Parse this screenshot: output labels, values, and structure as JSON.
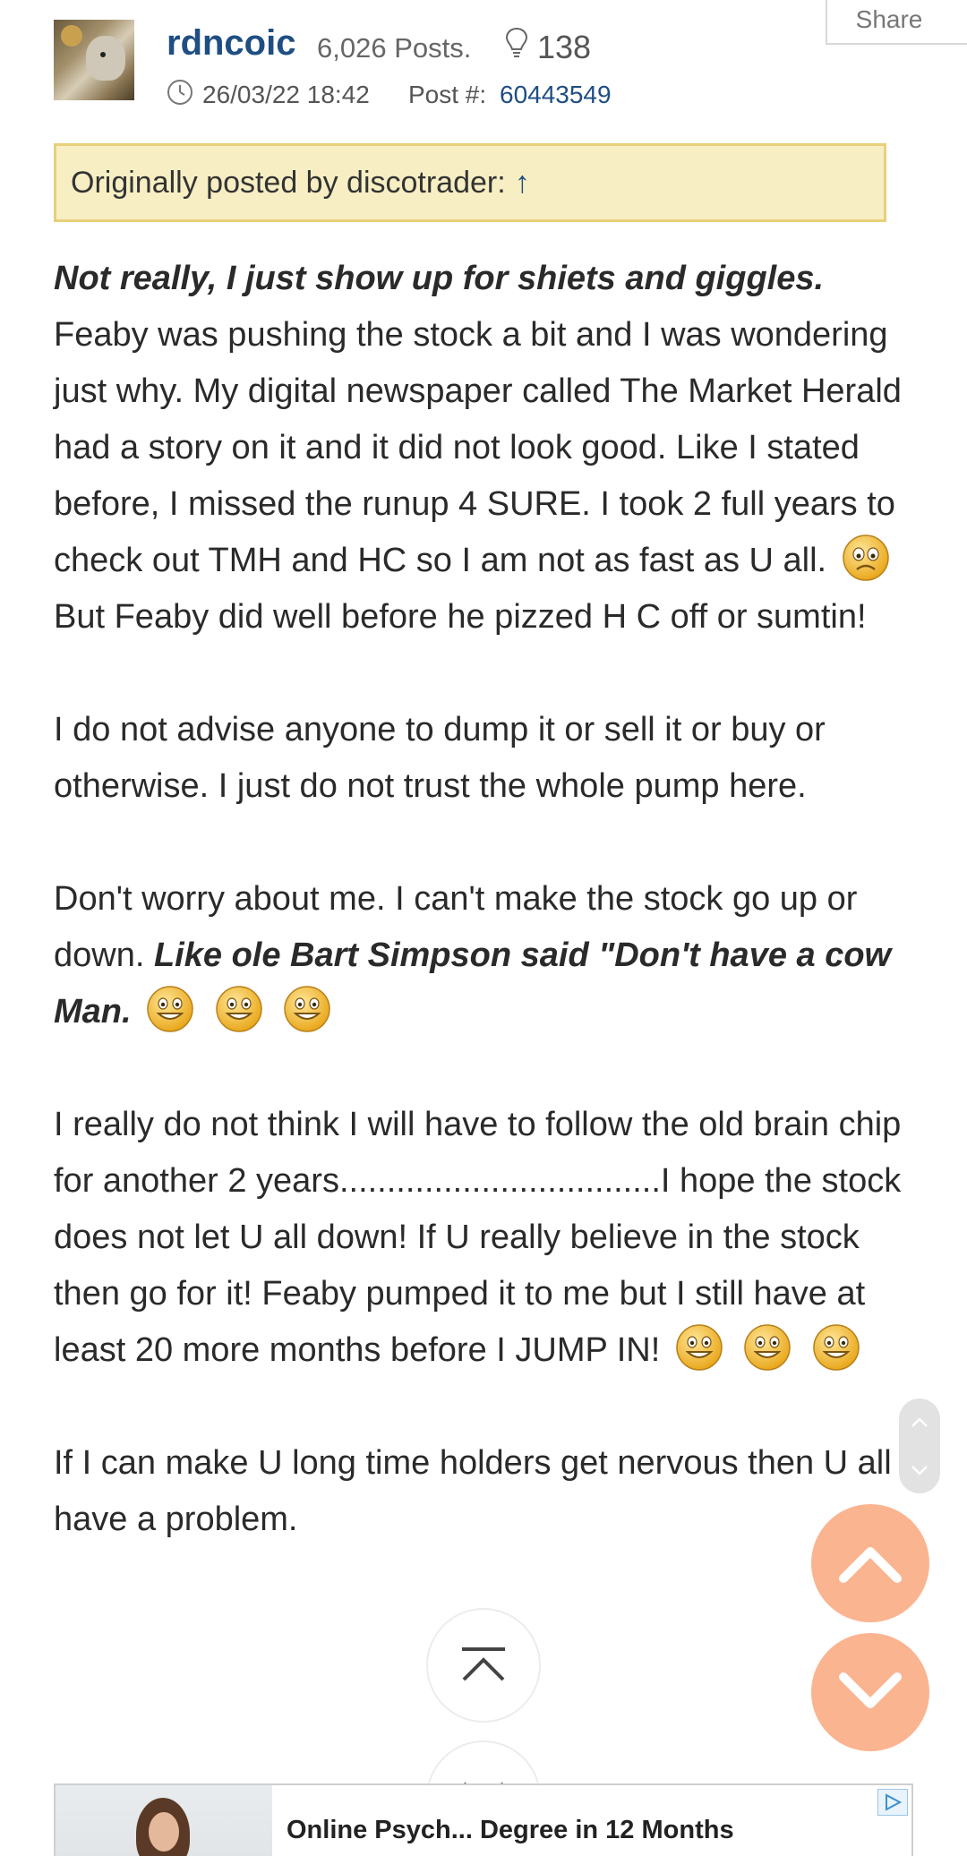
{
  "header": {
    "username": "rdncoic",
    "posts": "6,026 Posts.",
    "likes": "138",
    "datetime": "26/03/22 18:42",
    "post_label": "Post #:",
    "post_number": "60443549",
    "share_label": "Share"
  },
  "quote": {
    "label": "Originally posted by discotrader:",
    "arrow": "↑"
  },
  "body": {
    "p1_bold": "Not really, I just show up for shiets and giggles.",
    "p1_text": "Feaby was pushing the stock a bit and I was wondering just why. My digital newspaper called The Market Herald had a story on it and it did not look good. Like I stated before, I missed the runup 4 SURE. I took 2 full years to check out TMH and HC so I am not as fast as U all.",
    "p1_tail": "But Feaby did well before he pizzed H C off or sumtin!",
    "p2": "I do not advise anyone to dump it or sell it or buy or otherwise. I just do not trust the whole pump here.",
    "p3_text": "Don't worry about me. I can't make the stock go up or down.",
    "p3_bold": "Like ole Bart Simpson said \"Don't have a cow Man.",
    "p4_text": "I really do not think I will have to follow the old brain chip for another 2 years..................................I hope the stock does not let U all down! If U really believe in the stock then go for it! Feaby pumped it to me but I still have at least 20 more months before I JUMP IN!",
    "p5": "If I can make U long time holders get nervous then U all have a problem."
  },
  "ad": {
    "text": "Online Psych... Degree in 12 Months"
  },
  "icons": {
    "sad": "sad-face-icon",
    "grin": "grin-face-icon",
    "bulb": "lightbulb-icon",
    "clock": "clock-icon"
  },
  "colors": {
    "link": "#1f4e82",
    "quote_bg": "#f7efc3",
    "quote_border": "#e8cf7d",
    "fab": "#fbb490"
  }
}
